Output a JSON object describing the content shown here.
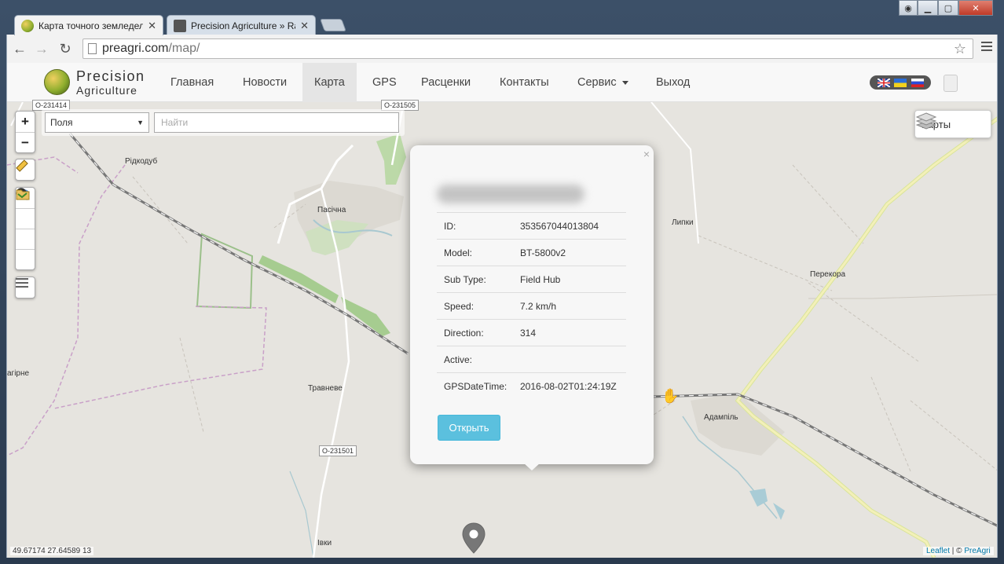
{
  "browser": {
    "tabs": [
      {
        "title": "Карта точного земледелия",
        "favicon_color": "#8fae2e",
        "active": true
      },
      {
        "title": "Precision Agriculture » Ra",
        "favicon_color": "#555555",
        "active": false
      }
    ],
    "address": {
      "host": "preagri.com",
      "path": "/map/"
    },
    "window_controls": [
      "user-icon",
      "minimize-icon",
      "maximize-icon",
      "close-icon"
    ]
  },
  "site": {
    "logo": {
      "line1": "Precision",
      "line2": "Agriculture"
    },
    "nav": [
      {
        "label": "Главная"
      },
      {
        "label": "Новости"
      },
      {
        "label": "Карта",
        "active": true
      },
      {
        "label": "GPS"
      },
      {
        "label": "Расценки"
      },
      {
        "label": "Контакты"
      },
      {
        "label": "Сервис",
        "dropdown": true
      },
      {
        "label": "Выход"
      }
    ],
    "languages": [
      "en-flag-icon",
      "ua-flag-icon",
      "ru-flag-icon"
    ]
  },
  "map": {
    "filter": {
      "select_value": "Поля",
      "search_placeholder": "Найти"
    },
    "zoom": {
      "in": "+",
      "out": "−"
    },
    "tools": [
      "ruler-icon",
      "layers-stack-icon",
      "search-icon",
      "locate-icon",
      "folder-icon",
      "list-icon"
    ],
    "layers_button": "Карты",
    "places": [
      "Рідкодуб",
      "Пасічна",
      "Липки",
      "Перекора",
      "агірне",
      "Травневе",
      "Адампіль",
      "Івки"
    ],
    "road_labels": [
      "О-231414",
      "О-231505",
      "О-231501"
    ],
    "coords": "49.67174 27.64589 13",
    "attribution": {
      "leaflet": "Leaflet",
      "sep": " | © ",
      "preagri": "PreAgri"
    }
  },
  "popup": {
    "close": "×",
    "rows": [
      {
        "key": "ID:",
        "value": "353567044013804"
      },
      {
        "key": "Model:",
        "value": "BT-5800v2"
      },
      {
        "key": "Sub Type:",
        "value": "Field Hub"
      },
      {
        "key": "Speed:",
        "value": "7.2 km/h"
      },
      {
        "key": "Direction:",
        "value": "314"
      },
      {
        "key": "Active:",
        "value": ""
      },
      {
        "key": "GPSDateTime:",
        "value": "2016-08-02T01:24:19Z"
      }
    ],
    "open_button": "Открыть"
  }
}
